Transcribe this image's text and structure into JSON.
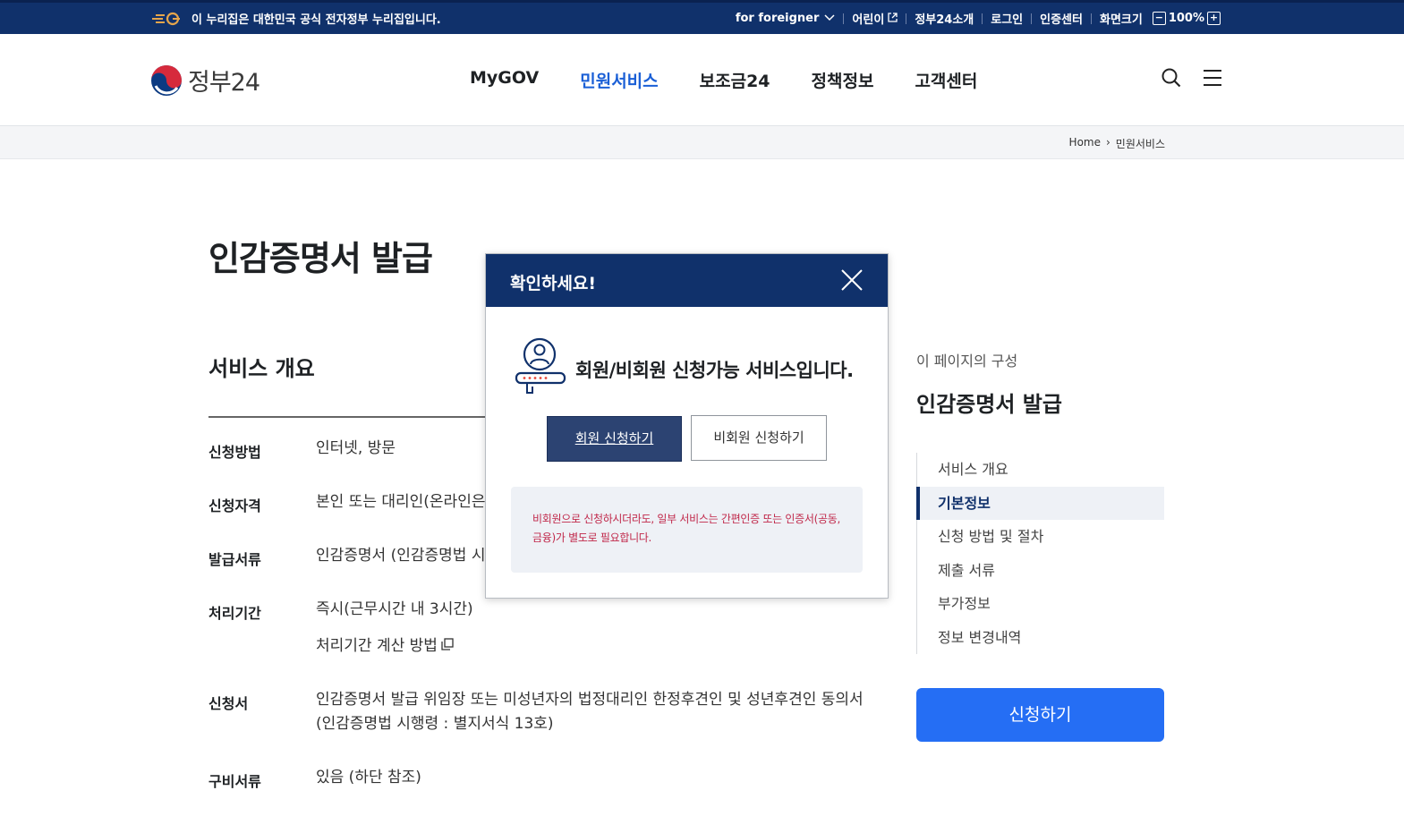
{
  "gov_bar": {
    "notice": "이 누리집은 대한민국 공식 전자정부 누리집입니다.",
    "links": [
      "for foreigner",
      "어린이",
      "정부24소개",
      "로그인",
      "인증센터",
      "화면크기"
    ],
    "zoom": "100%",
    "colors": {
      "bg": "#10316b"
    }
  },
  "header": {
    "logo_text": "정부24",
    "nav": [
      "MyGOV",
      "민원서비스",
      "보조금24",
      "정책정보",
      "고객센터"
    ],
    "active_nav": "민원서비스"
  },
  "breadcrumb": {
    "home": "Home",
    "current": "민원서비스"
  },
  "page": {
    "title": "인감증명서 발급",
    "section_title": "서비스 개요",
    "rows": [
      {
        "label": "신청방법",
        "value": "인터넷, 방문"
      },
      {
        "label": "신청자격",
        "value": "본인 또는 대리인(온라인은 "
      },
      {
        "label": "발급서류",
        "value": "인감증명서 (인감증명법 시행"
      },
      {
        "label": "처리기간",
        "value": "즉시(근무시간 내 3시간)",
        "extra": "처리기간 계산 방법"
      },
      {
        "label": "신청서",
        "value": "인감증명서 발급 위임장 또는 미성년자의 법정대리인 한정후견인 및 성년후견인 동의서",
        "value2": "(인감증명법 시행령 : 별지서식 13호)"
      },
      {
        "label": "구비서류",
        "value": "있음 (하단 참조)"
      }
    ]
  },
  "toc": {
    "caption": "이 페이지의 구성",
    "title": "인감증명서 발급",
    "items": [
      "서비스 개요",
      "기본정보",
      "신청 방법 및 절차",
      "제출 서류",
      "부가정보",
      "정보 변경내역"
    ],
    "active_index": 1,
    "apply_label": "신청하기"
  },
  "modal": {
    "title": "확인하세요!",
    "message": "회원/비회원 신청가능 서비스입니다.",
    "member_button": "회원 신청하기",
    "guest_button": "비회원 신청하기",
    "notice_line1": "비회원으로 신청하시더라도, 일부 서비스는 간편인증 또는 인증서(공동,",
    "notice_line2": "금융)가 별도로 필요합니다."
  }
}
